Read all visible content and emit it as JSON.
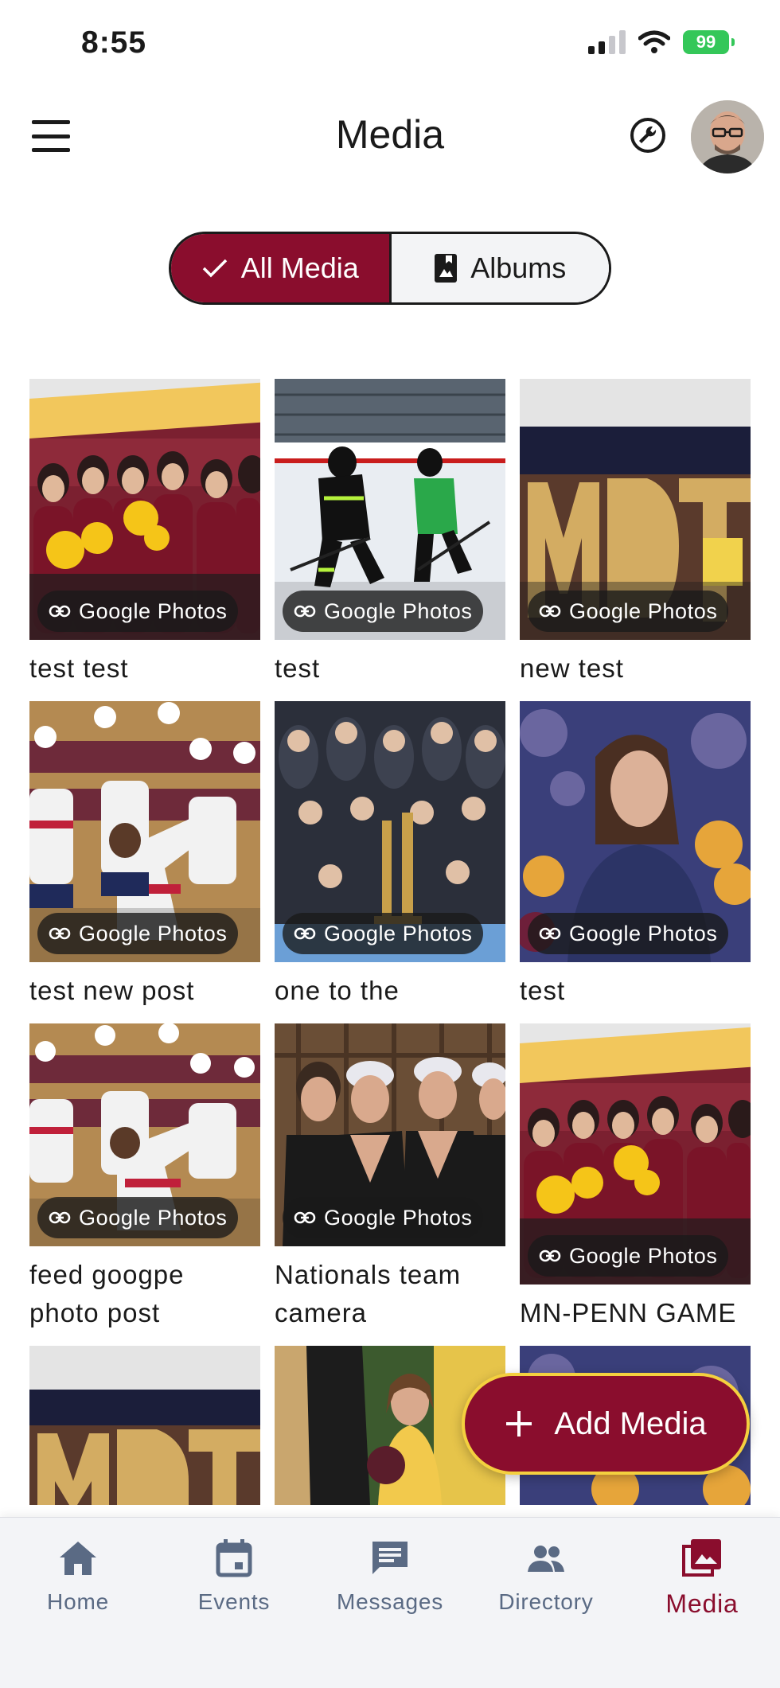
{
  "status_bar": {
    "time": "8:55",
    "battery": "99"
  },
  "header": {
    "title": "Media"
  },
  "toggle": {
    "all_media": "All Media",
    "albums": "Albums"
  },
  "media": [
    {
      "caption": "test test",
      "source": "Google Photos"
    },
    {
      "caption": "test",
      "source": "Google Photos"
    },
    {
      "caption": "new test",
      "source": "Google Photos"
    },
    {
      "caption": "test new post",
      "source": "Google Photos"
    },
    {
      "caption": "one to the",
      "source": "Google Photos"
    },
    {
      "caption": "test",
      "source": "Google Photos"
    },
    {
      "caption": "feed googpe photo post",
      "source": "Google Photos"
    },
    {
      "caption": "Nationals team camera",
      "source": "Google Photos"
    },
    {
      "caption": "MN-PENN GAME",
      "source": "Google Photos"
    }
  ],
  "fab": {
    "label": "Add Media"
  },
  "nav": [
    {
      "label": "Home",
      "icon": "home-icon"
    },
    {
      "label": "Events",
      "icon": "calendar-icon"
    },
    {
      "label": "Messages",
      "icon": "message-icon"
    },
    {
      "label": "Directory",
      "icon": "people-icon"
    },
    {
      "label": "Media",
      "icon": "photo-library-icon"
    }
  ],
  "colors": {
    "accent": "#8a0d2d",
    "fab_border": "#f4d03f",
    "nav_inactive": "#5a6a84"
  }
}
